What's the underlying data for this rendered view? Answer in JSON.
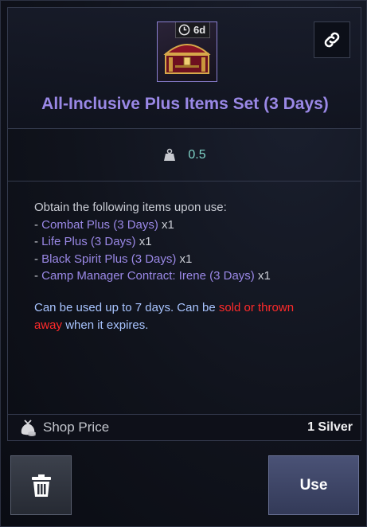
{
  "item": {
    "name": "All-Inclusive Plus Items Set (3 Days)",
    "timer": "6d",
    "weight": "0.5"
  },
  "description": {
    "intro": "Obtain the following items upon use:",
    "items": [
      {
        "prefix": "- ",
        "name": "Combat Plus (3 Days)",
        "qty": " x1"
      },
      {
        "prefix": "- ",
        "name": "Life Plus (3 Days)",
        "qty": " x1"
      },
      {
        "prefix": "- ",
        "name": "Black Spirit Plus (3 Days)",
        "qty": " x1"
      },
      {
        "prefix": "- ",
        "name": "Camp Manager Contract: Irene (3 Days)",
        "qty": " x1"
      }
    ],
    "note_part1": "Can be used up to 7 days. Can be ",
    "note_red": "sold or thrown away",
    "note_part2": " when it expires."
  },
  "shop": {
    "label": "Shop Price",
    "value": "1 Silver"
  },
  "buttons": {
    "use": "Use"
  },
  "colors": {
    "item_name": "#9a88e6",
    "weight": "#7fd3c7",
    "note": "#a8c4ff",
    "warning": "#ff2a2a"
  },
  "icons": [
    "chest-icon",
    "clock-icon",
    "link-icon",
    "weight-icon",
    "money-bag-icon",
    "trash-icon"
  ]
}
